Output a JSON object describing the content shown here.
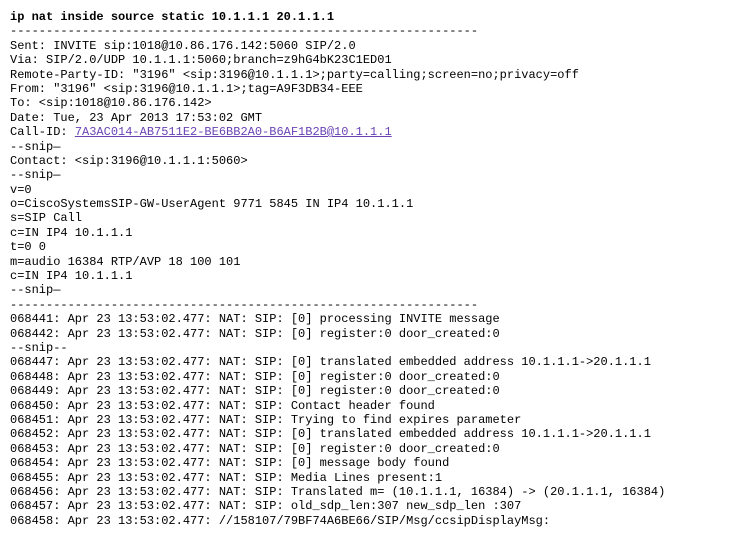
{
  "command": "ip nat inside source static 10.1.1.1 20.1.1.1",
  "rule1": "-----------------------------------------------------------------",
  "sip": {
    "sent": "Sent: INVITE sip:1018@10.86.176.142:5060 SIP/2.0",
    "via": "Via: SIP/2.0/UDP 10.1.1.1:5060;branch=z9hG4bK23C1ED01",
    "remoteParty": "Remote-Party-ID: \"3196\" <sip:3196@10.1.1.1>;party=calling;screen=no;privacy=off",
    "from": "From: \"3196\" <sip:3196@10.1.1.1>;tag=A9F3DB34-EEE",
    "to": "To: <sip:1018@10.86.176.142>",
    "date": "Date: Tue, 23 Apr 2013 17:53:02 GMT",
    "callIdLabel": "Call-ID: ",
    "callIdValue": "7A3AC014-AB7511E2-BE6BB2A0-B6AF1B2B@10.1.1.1",
    "contact": "Contact: <sip:3196@10.1.1.1:5060>"
  },
  "snip1": "--snip—",
  "snip2": "--snip—",
  "sdp": {
    "v": "v=0",
    "o": "o=CiscoSystemsSIP-GW-UserAgent 9771 5845 IN IP4 10.1.1.1",
    "s": "s=SIP Call",
    "c": "c=IN IP4 10.1.1.1",
    "t": "t=0 0",
    "m": "m=audio 16384 RTP/AVP 18 100 101",
    "c2": "c=IN IP4 10.1.1.1"
  },
  "snip3": "--snip—",
  "rule2": "-----------------------------------------------------------------",
  "log": {
    "l1": "068441: Apr 23 13:53:02.477: NAT: SIP: [0] processing INVITE message",
    "l2": "068442: Apr 23 13:53:02.477: NAT: SIP: [0] register:0 door_created:0",
    "l3": "--snip--",
    "l4": "068447: Apr 23 13:53:02.477: NAT: SIP: [0] translated embedded address 10.1.1.1->20.1.1.1",
    "l5": "068448: Apr 23 13:53:02.477: NAT: SIP: [0] register:0 door_created:0",
    "l6": "068449: Apr 23 13:53:02.477: NAT: SIP: [0] register:0 door_created:0",
    "l7": "068450: Apr 23 13:53:02.477: NAT: SIP: Contact header found",
    "l8": "068451: Apr 23 13:53:02.477: NAT: SIP: Trying to find expires parameter",
    "l9": "068452: Apr 23 13:53:02.477: NAT: SIP: [0] translated embedded address 10.1.1.1->20.1.1.1",
    "l10": "068453: Apr 23 13:53:02.477: NAT: SIP: [0] register:0 door_created:0",
    "l11": "068454: Apr 23 13:53:02.477: NAT: SIP: [0] message body found",
    "l12": "068455: Apr 23 13:53:02.477: NAT: SIP: Media Lines present:1",
    "l13": "068456: Apr 23 13:53:02.477: NAT: SIP: Translated m= (10.1.1.1, 16384) -> (20.1.1.1, 16384)",
    "l14": "068457: Apr 23 13:53:02.477: NAT: SIP: old_sdp_len:307 new_sdp_len :307",
    "l15": "068458: Apr 23 13:53:02.477: //158107/79BF74A6BE66/SIP/Msg/ccsipDisplayMsg:"
  }
}
